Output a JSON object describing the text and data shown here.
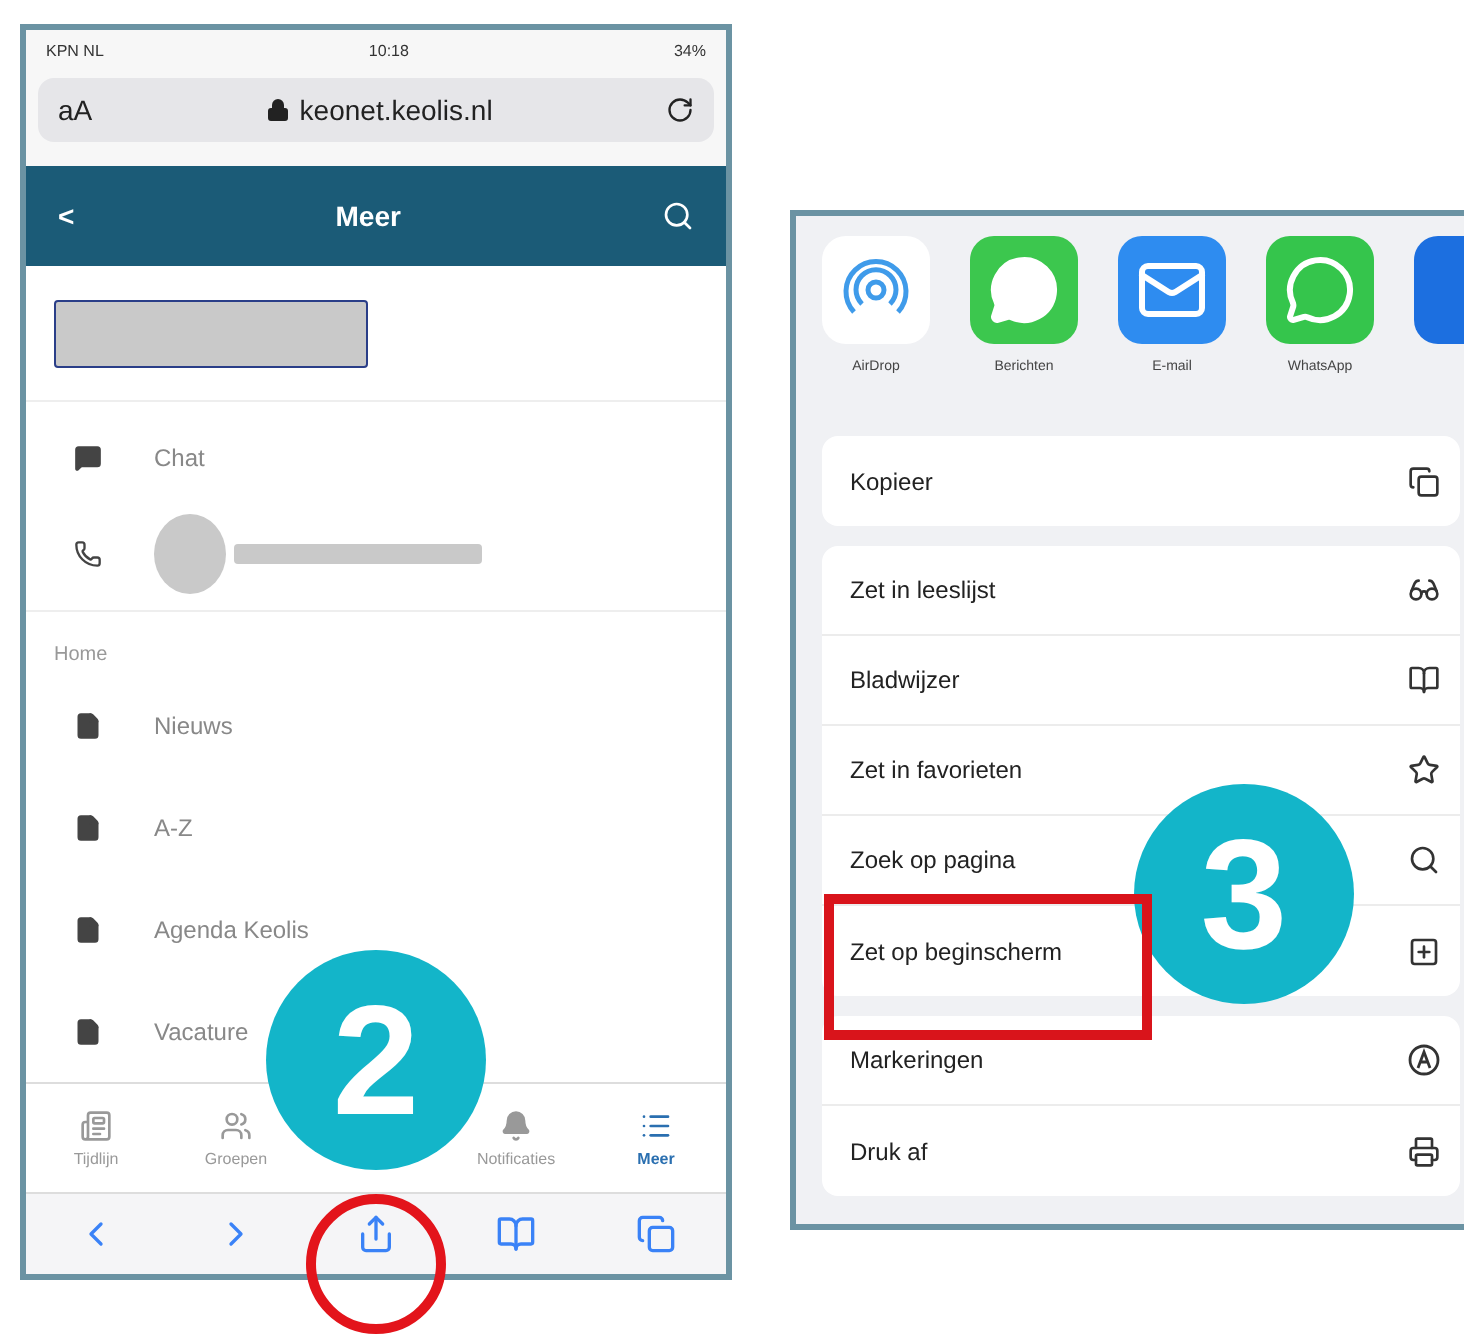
{
  "left_phone": {
    "status_bar": {
      "carrier": "KPN NL",
      "time": "10:18",
      "battery": "34%"
    },
    "address_bar": {
      "text_size": "aA",
      "url": "keonet.keolis.nl"
    },
    "header": {
      "back": "<",
      "title": "Meer"
    },
    "contact_items": [
      {
        "kind": "chat",
        "label": "Chat"
      },
      {
        "kind": "phone"
      }
    ],
    "section": "Home",
    "menu_items": [
      {
        "label": "Nieuws"
      },
      {
        "label": "A-Z"
      },
      {
        "label": "Agenda Keolis"
      },
      {
        "label": "Vacature"
      }
    ],
    "tabs": [
      {
        "kind": "timeline",
        "label": "Tijdlijn",
        "selected": false
      },
      {
        "kind": "groups",
        "label": "Groepen",
        "selected": false
      },
      {
        "kind": "covered"
      },
      {
        "kind": "bell",
        "label": "Notificaties",
        "selected": false
      },
      {
        "kind": "list",
        "label": "Meer",
        "selected": true
      }
    ],
    "toolbar": [
      {
        "kind": "back"
      },
      {
        "kind": "forward"
      },
      {
        "kind": "share"
      },
      {
        "kind": "bookmarks"
      },
      {
        "kind": "tabs"
      }
    ]
  },
  "share_sheet": {
    "apps": [
      {
        "kind": "airdrop",
        "label": "AirDrop"
      },
      {
        "kind": "messages",
        "label": "Berichten"
      },
      {
        "kind": "mail",
        "label": "E-mail"
      },
      {
        "kind": "whatsapp",
        "label": "WhatsApp"
      },
      {
        "kind": "partial"
      }
    ],
    "groups": [
      [
        {
          "label": "Kopieer",
          "kind": "copy"
        }
      ],
      [
        {
          "label": "Zet in leeslijst",
          "kind": "glasses"
        },
        {
          "label": "Bladwijzer",
          "kind": "book"
        },
        {
          "label": "Zet in favorieten",
          "kind": "star"
        },
        {
          "label": "Zoek op pagina",
          "kind": "search"
        },
        {
          "label": "Zet op beginscherm",
          "kind": "add"
        }
      ],
      [
        {
          "label": "Markeringen",
          "kind": "markup"
        },
        {
          "label": "Druk af",
          "kind": "print"
        }
      ]
    ]
  },
  "annotations": [
    {
      "kind": "badge",
      "label": "2"
    },
    {
      "kind": "circle"
    },
    {
      "kind": "badge",
      "label": "3"
    },
    {
      "kind": "rectangle"
    }
  ]
}
